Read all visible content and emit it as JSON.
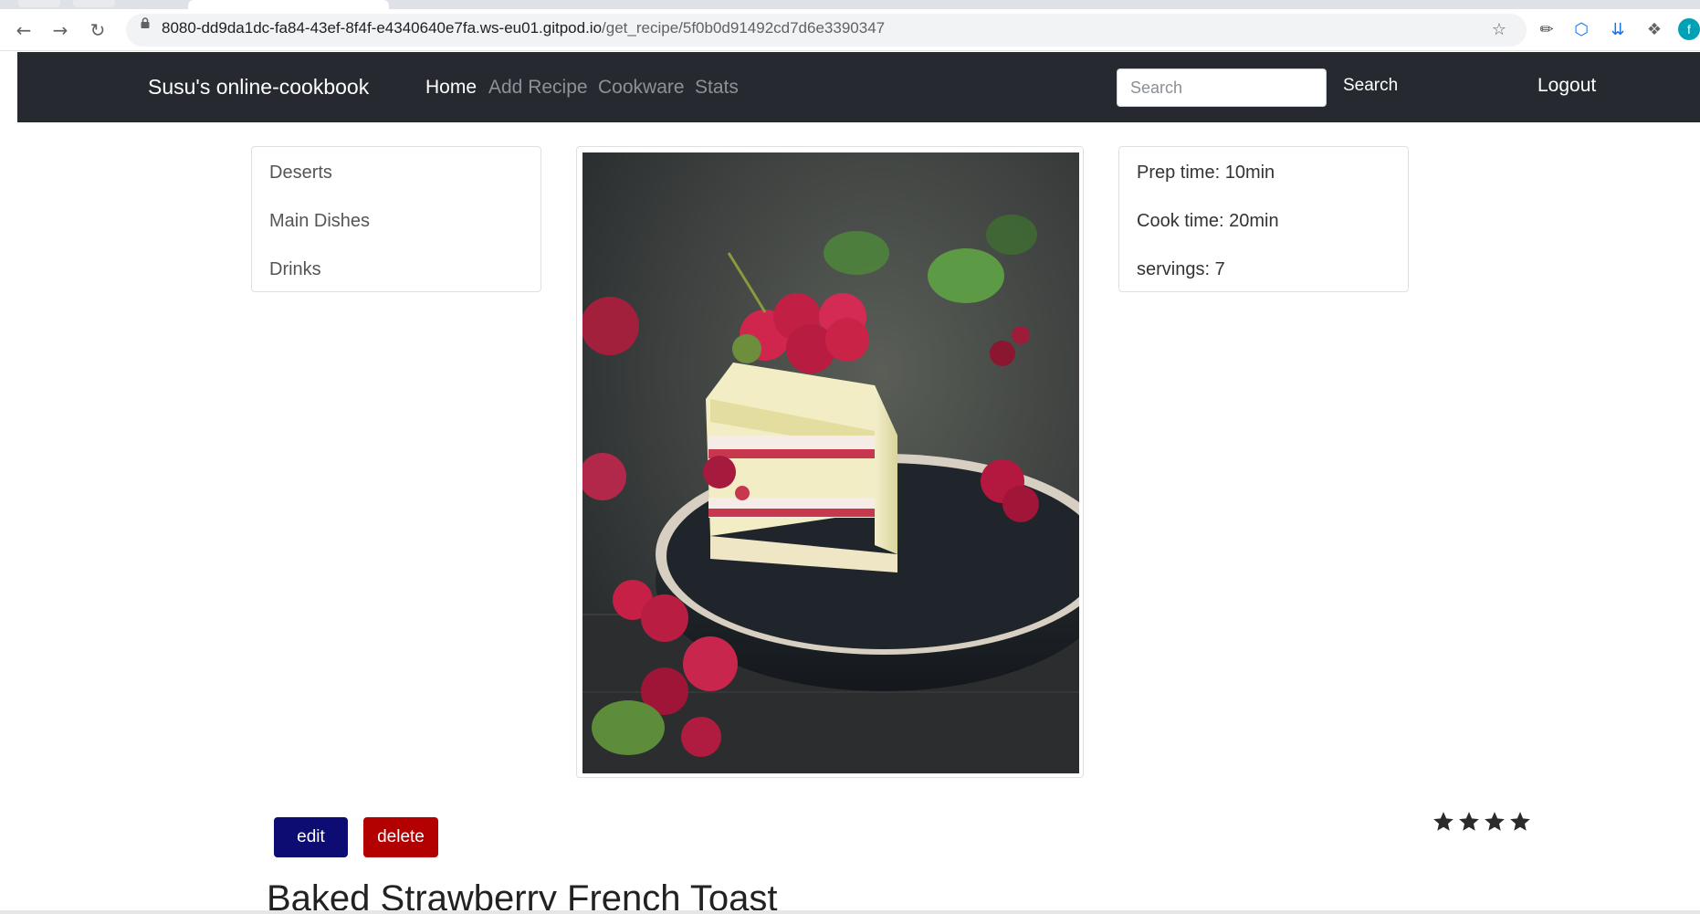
{
  "browser": {
    "url_host": "8080-dd9da1dc-fa84-43ef-8f4f-e4340640e7fa.ws-eu01.gitpod.io",
    "url_path": "/get_recipe/5f0b0d91492cd7d6e3390347",
    "profile_initial": "f"
  },
  "navbar": {
    "brand": "Susu's online-cookbook",
    "links": [
      {
        "label": "Home",
        "active": true
      },
      {
        "label": "Add Recipe",
        "active": false
      },
      {
        "label": "Cookware",
        "active": false
      },
      {
        "label": "Stats",
        "active": false
      }
    ],
    "search_placeholder": "Search",
    "search_button": "Search",
    "logout": "Logout"
  },
  "categories": [
    "Deserts",
    "Main Dishes",
    "Drinks"
  ],
  "recipe_info": {
    "prep_time": "Prep time: 10min",
    "cook_time": "Cook time: 20min",
    "servings": "servings: 7"
  },
  "actions": {
    "edit": "edit",
    "delete": "delete"
  },
  "rating": 4,
  "recipe": {
    "title": "Baked Strawberry French Toast"
  },
  "colors": {
    "navbar_bg": "#262a30",
    "edit_btn": "#0c0c73",
    "delete_btn": "#b30000"
  }
}
